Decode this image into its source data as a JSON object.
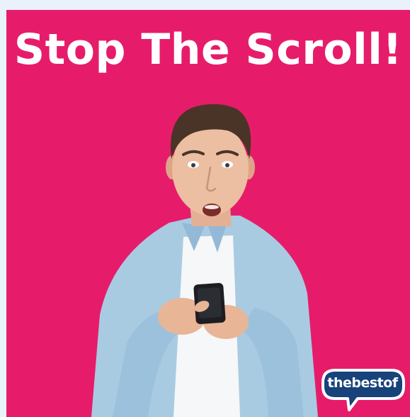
{
  "headline": "Stop The Scroll!",
  "logo": {
    "text": "thebestof"
  },
  "colors": {
    "background": "#e61c6b",
    "page": "#e9f2fb",
    "headline_text": "#ffffff",
    "logo_fill": "#17427a",
    "logo_border": "#ffffff"
  },
  "icons": [
    "speech-bubble-logo-icon"
  ]
}
